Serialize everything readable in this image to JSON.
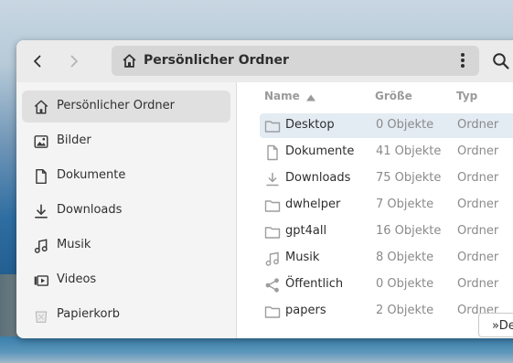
{
  "window": {
    "path_label": "Persönlicher Ordner"
  },
  "sidebar": {
    "items": [
      {
        "label": "Persönlicher Ordner",
        "icon": "home-icon",
        "active": true
      },
      {
        "label": "Bilder",
        "icon": "image-icon"
      },
      {
        "label": "Dokumente",
        "icon": "document-icon"
      },
      {
        "label": "Downloads",
        "icon": "download-icon"
      },
      {
        "label": "Musik",
        "icon": "music-icon"
      },
      {
        "label": "Videos",
        "icon": "video-icon"
      },
      {
        "label": "Papierkorb",
        "icon": "trash-icon"
      }
    ]
  },
  "file_list": {
    "columns": {
      "name": "Name",
      "size": "Größe",
      "type": "Typ"
    },
    "sort": "name-ascending",
    "rows": [
      {
        "name": "Desktop",
        "size": "0 Objekte",
        "type": "Ordner",
        "icon": "folder-icon",
        "selected": true
      },
      {
        "name": "Dokumente",
        "size": "41 Objekte",
        "type": "Ordner",
        "icon": "document-folder-icon"
      },
      {
        "name": "Downloads",
        "size": "75 Objekte",
        "type": "Ordner",
        "icon": "download-folder-icon"
      },
      {
        "name": "dwhelper",
        "size": "7 Objekte",
        "type": "Ordner",
        "icon": "folder-icon"
      },
      {
        "name": "gpt4all",
        "size": "16 Objekte",
        "type": "Ordner",
        "icon": "folder-icon"
      },
      {
        "name": "Musik",
        "size": "8 Objekte",
        "type": "Ordner",
        "icon": "music-folder-icon"
      },
      {
        "name": "Öffentlich",
        "size": "0 Objekte",
        "type": "Ordner",
        "icon": "share-folder-icon"
      },
      {
        "name": "papers",
        "size": "2 Objekte",
        "type": "Ordner",
        "icon": "folder-icon"
      }
    ]
  },
  "tooltip": {
    "text": "»De"
  },
  "colors": {
    "headerbar": "#ebebeb",
    "pathbar": "#d6d6d6",
    "sidebar": "#f4f4f4",
    "sidebar_active": "#e0e0e0",
    "row_selected": "#e3ebf3"
  }
}
